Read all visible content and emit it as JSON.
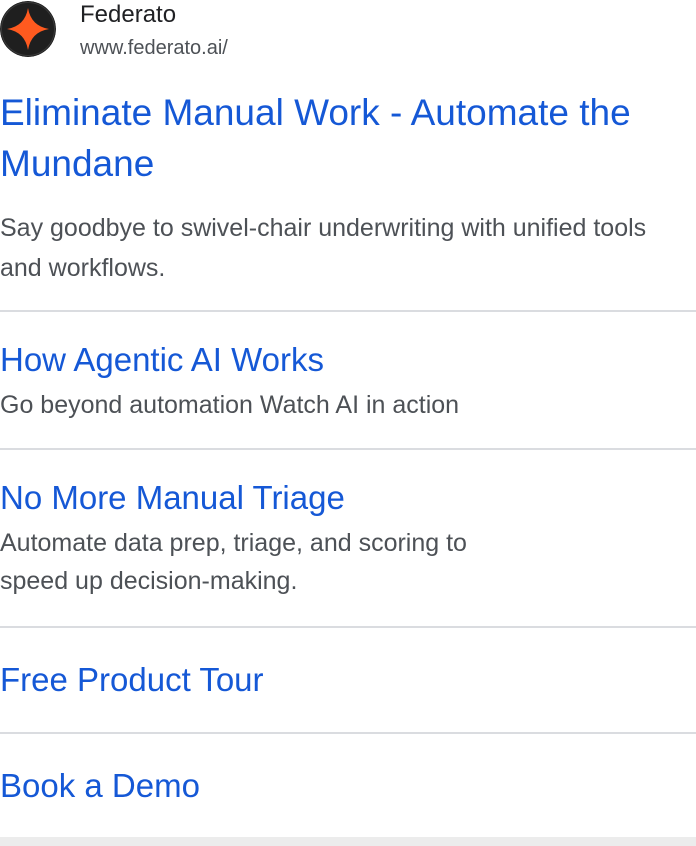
{
  "site": {
    "name": "Federato",
    "url": "www.federato.ai/"
  },
  "result": {
    "title": "Eliminate Manual Work - Automate the Mundane",
    "description": "Say goodbye to swivel-chair underwriting with unified tools and workflows."
  },
  "sitelinks": [
    {
      "title": "How Agentic AI Works",
      "description": "Go beyond automation Watch AI in action"
    },
    {
      "title": "No More Manual Triage",
      "description": "Automate data prep, triage, and scoring to speed up decision-making."
    },
    {
      "title": "Free Product Tour"
    },
    {
      "title": "Book a Demo"
    }
  ],
  "colors": {
    "link": "#1558d6",
    "snippet_text": "#4d5156",
    "title_text": "#202124",
    "favicon_bg": "#1f1f1f",
    "favicon_star": "#ff5a1f",
    "divider": "#dadce0"
  },
  "icons": {
    "favicon": "federato-star-logo-icon"
  }
}
